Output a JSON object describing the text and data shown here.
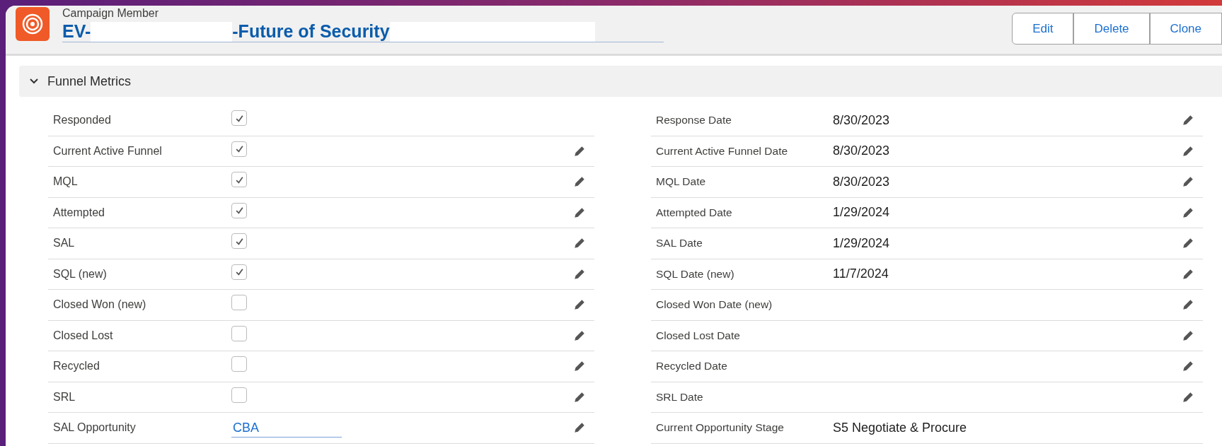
{
  "header": {
    "object_type": "Campaign Member",
    "title_parts": [
      "EV-",
      "-Future of Security"
    ]
  },
  "actions": [
    "Edit",
    "Delete",
    "Clone"
  ],
  "section": {
    "title": "Funnel Metrics",
    "expanded": true
  },
  "rows": [
    {
      "left": {
        "label": "Responded",
        "kind": "checkbox",
        "checked": true,
        "editable": false
      },
      "right": {
        "label": "Response Date",
        "value": "8/30/2023",
        "editable": true
      }
    },
    {
      "left": {
        "label": "Current Active Funnel",
        "kind": "checkbox",
        "checked": true,
        "editable": true
      },
      "right": {
        "label": "Current Active Funnel Date",
        "value": "8/30/2023",
        "editable": true
      }
    },
    {
      "left": {
        "label": "MQL",
        "kind": "checkbox",
        "checked": true,
        "editable": true
      },
      "right": {
        "label": "MQL Date",
        "value": "8/30/2023",
        "editable": true
      }
    },
    {
      "left": {
        "label": "Attempted",
        "kind": "checkbox",
        "checked": true,
        "editable": true
      },
      "right": {
        "label": "Attempted Date",
        "value": "1/29/2024",
        "editable": true
      }
    },
    {
      "left": {
        "label": "SAL",
        "kind": "checkbox",
        "checked": true,
        "editable": true
      },
      "right": {
        "label": "SAL Date",
        "value": "1/29/2024",
        "editable": true
      }
    },
    {
      "left": {
        "label": "SQL (new)",
        "kind": "checkbox",
        "checked": true,
        "editable": true
      },
      "right": {
        "label": "SQL Date (new)",
        "value": "11/7/2024",
        "editable": true
      }
    },
    {
      "left": {
        "label": "Closed Won (new)",
        "kind": "checkbox",
        "checked": false,
        "editable": true
      },
      "right": {
        "label": "Closed Won Date (new)",
        "editable": true
      }
    },
    {
      "left": {
        "label": "Closed Lost",
        "kind": "checkbox",
        "checked": false,
        "editable": true
      },
      "right": {
        "label": "Closed Lost Date",
        "editable": true
      }
    },
    {
      "left": {
        "label": "Recycled",
        "kind": "checkbox",
        "checked": false,
        "editable": true
      },
      "right": {
        "label": "Recycled Date",
        "editable": true
      }
    },
    {
      "left": {
        "label": "SRL",
        "kind": "checkbox",
        "checked": false,
        "editable": true
      },
      "right": {
        "label": "SRL Date",
        "editable": true
      }
    },
    {
      "left": {
        "label": "SAL Opportunity",
        "kind": "link",
        "value": "CBA",
        "editable": true
      },
      "right": {
        "label": "Current Opportunity Stage",
        "value": "S5 Negotiate & Procure",
        "editable": false
      }
    }
  ]
}
